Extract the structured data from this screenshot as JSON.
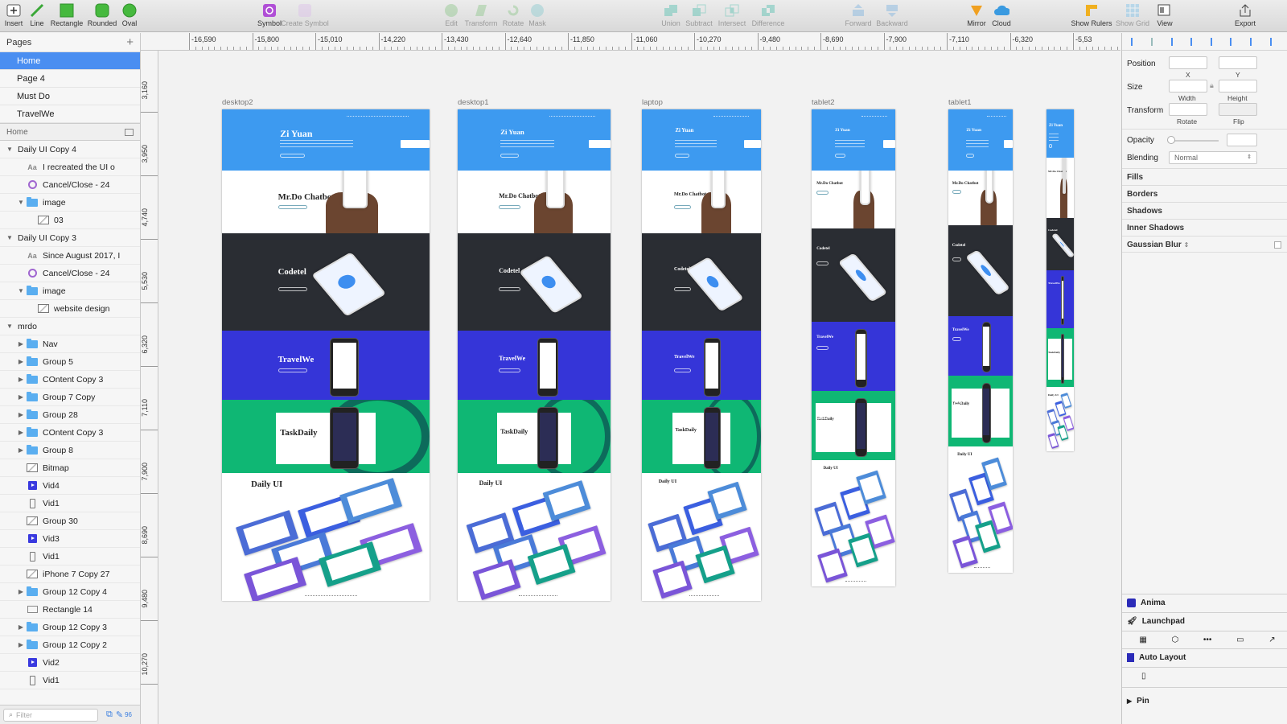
{
  "toolbar": {
    "insert": "Insert",
    "line": "Line",
    "rectangle": "Rectangle",
    "rounded": "Rounded",
    "oval": "Oval",
    "symbol": "Symbol",
    "create_symbol": "Create Symbol",
    "edit": "Edit",
    "transform": "Transform",
    "rotate": "Rotate",
    "mask": "Mask",
    "union": "Union",
    "subtract": "Subtract",
    "intersect": "Intersect",
    "difference": "Difference",
    "forward": "Forward",
    "backward": "Backward",
    "mirror": "Mirror",
    "cloud": "Cloud",
    "show_rulers": "Show Rulers",
    "show_grid": "Show Grid",
    "view": "View",
    "export": "Export"
  },
  "pages": {
    "title": "Pages",
    "items": [
      {
        "label": "Home"
      },
      {
        "label": "Page 4"
      },
      {
        "label": "Must Do"
      },
      {
        "label": "TravelWe"
      }
    ]
  },
  "layers": {
    "title": "Home",
    "items": [
      {
        "label": "Daily UI Copy 4",
        "icon": "group",
        "expanded": true
      },
      {
        "label": "I recreated the UI o",
        "icon": "text"
      },
      {
        "label": "Cancel/Close - 24",
        "icon": "symbol"
      },
      {
        "label": "image",
        "icon": "folder",
        "expanded": true
      },
      {
        "label": "03",
        "icon": "bitmap"
      },
      {
        "label": "Daily UI Copy 3",
        "icon": "group",
        "expanded": true
      },
      {
        "label": "Since August 2017, I",
        "icon": "text"
      },
      {
        "label": "Cancel/Close - 24",
        "icon": "symbol"
      },
      {
        "label": "image",
        "icon": "folder",
        "expanded": true
      },
      {
        "label": "website design",
        "icon": "bitmap"
      },
      {
        "label": "mrdo",
        "icon": "group",
        "expanded": true
      },
      {
        "label": "Nav",
        "icon": "folder"
      },
      {
        "label": "Group 5",
        "icon": "folder"
      },
      {
        "label": "COntent Copy 3",
        "icon": "folder"
      },
      {
        "label": "Group 7 Copy",
        "icon": "folder"
      },
      {
        "label": "Group 28",
        "icon": "folder"
      },
      {
        "label": "COntent Copy 3",
        "icon": "folder"
      },
      {
        "label": "Group 8",
        "icon": "folder"
      },
      {
        "label": "Bitmap",
        "icon": "bitmap"
      },
      {
        "label": "Vid4",
        "icon": "video"
      },
      {
        "label": "Vid1",
        "icon": "phone"
      },
      {
        "label": "Group 30",
        "icon": "bitmap"
      },
      {
        "label": "Vid3",
        "icon": "video"
      },
      {
        "label": "Vid1",
        "icon": "phone"
      },
      {
        "label": "iPhone 7 Copy 27",
        "icon": "bitmap"
      },
      {
        "label": "Group 12 Copy 4",
        "icon": "folder"
      },
      {
        "label": "Rectangle 14",
        "icon": "rect"
      },
      {
        "label": "Group 12 Copy 3",
        "icon": "folder"
      },
      {
        "label": "Group 12 Copy 2",
        "icon": "folder"
      },
      {
        "label": "Vid2",
        "icon": "video"
      },
      {
        "label": "Vid1",
        "icon": "phone"
      }
    ],
    "filter_placeholder": "Filter",
    "count": "96"
  },
  "ruler": {
    "h": [
      "-16,590",
      "-15,800",
      "-15,010",
      "-14,220",
      "-13,430",
      "-12,640",
      "-11,850",
      "-11,060",
      "-10,270",
      "-9,480",
      "-8,690",
      "-7,900",
      "-7,110",
      "-6,320",
      "-5,53"
    ],
    "v": [
      "3,160",
      "3,950",
      "4,740",
      "5,530",
      "6,320",
      "7,110",
      "7,900",
      "8,690",
      "9,480",
      "10,270"
    ]
  },
  "artboards": [
    {
      "name": "desktop2",
      "headline": "Zi Yuan"
    },
    {
      "name": "desktop1",
      "headline": "Zi Yuan"
    },
    {
      "name": "laptop",
      "headline": "Zi Yuan"
    },
    {
      "name": "tablet2",
      "headline": "Zi Yuan"
    },
    {
      "name": "tablet1",
      "headline": "Zi Yuan"
    },
    {
      "name": "",
      "headline": "Zi Yuan"
    }
  ],
  "sections": {
    "chatbot": "Mr.Do Chatbot",
    "codetel": "Codetel",
    "travelwe": "TravelWe",
    "taskdaily": "TaskDaily",
    "daily_ui": "Daily UI"
  },
  "inspector": {
    "position": "Position",
    "x": "X",
    "y": "Y",
    "size": "Size",
    "width": "Width",
    "height": "Height",
    "transform": "Transform",
    "rotate": "Rotate",
    "flip": "Flip",
    "opacity": "Opacity",
    "blending": "Blending",
    "blending_value": "Normal",
    "fills": "Fills",
    "borders": "Borders",
    "shadows": "Shadows",
    "inner_shadows": "Inner Shadows",
    "gaussian_blur": "Gaussian Blur",
    "anima": "Anima",
    "launchpad": "Launchpad",
    "auto_layout": "Auto Layout",
    "pin": "Pin"
  },
  "colors": {
    "accent": "#4a8ef1",
    "hero": "#3d9af0",
    "dark": "#2a2d33",
    "travel": "#3535d8",
    "task": "#0fb774"
  }
}
